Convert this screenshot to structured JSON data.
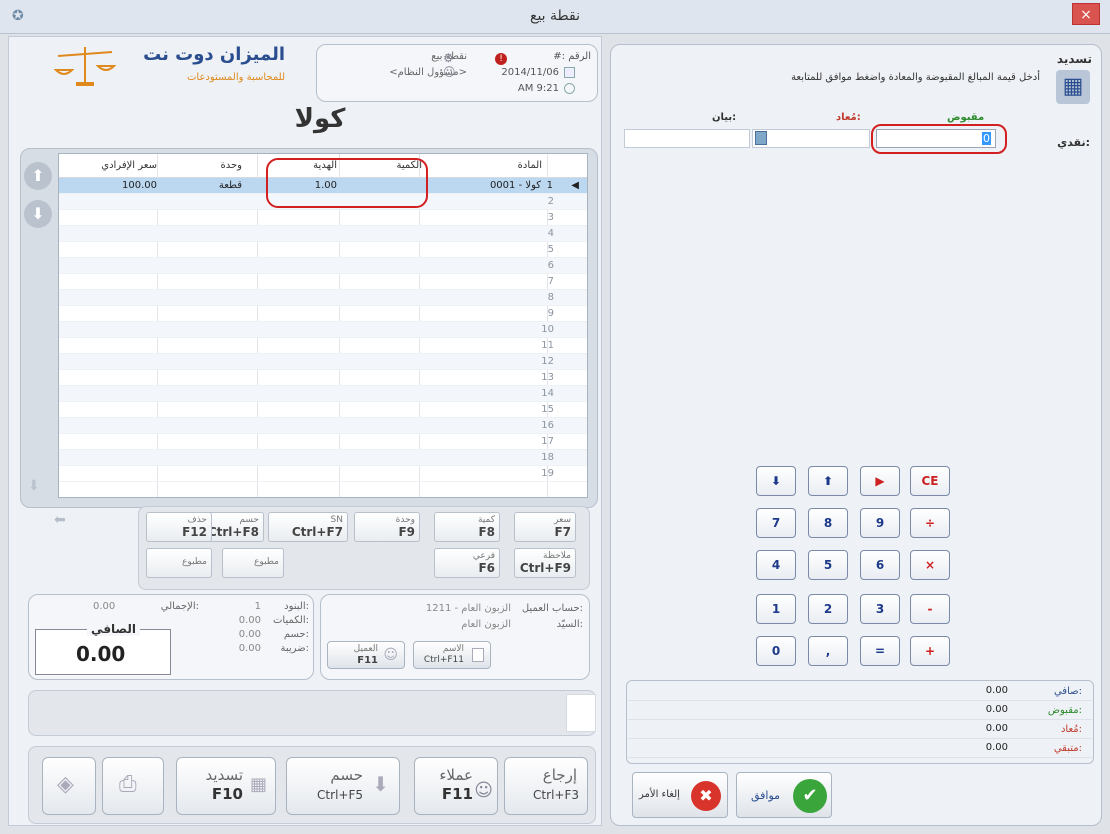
{
  "window": {
    "title": "نقطة بيع",
    "close_label": "×"
  },
  "brand": {
    "name": "الميزان دوت نت",
    "tagline": "للمحاسبة والمستودعات"
  },
  "doc_info": {
    "number_label": "#: الرقم",
    "date": "2014/11/06",
    "time": "AM 9:21",
    "pos_label": "نقطة بيع",
    "user": "<مسؤول النظام>"
  },
  "item_title": "كولا",
  "grid": {
    "headers": {
      "item": "المادة",
      "qty": "الكمية",
      "gift": "الهدية",
      "unit": "وحدة",
      "price": "سعر الإفرادي"
    },
    "first_row": {
      "num": "1",
      "item": "0001 - كولا",
      "gift": "1.00",
      "unit": "قطعة",
      "price": "100.00"
    },
    "row_numbers": [
      "2",
      "3",
      "4",
      "5",
      "6",
      "7",
      "8",
      "9",
      "10",
      "11",
      "12",
      "13",
      "14",
      "15",
      "16",
      "17",
      "18",
      "19"
    ]
  },
  "func_buttons": [
    {
      "name": "price-button",
      "label": "سعر",
      "key": "F7"
    },
    {
      "name": "qty-button",
      "label": "كمية",
      "key": "F8"
    },
    {
      "name": "unit-button",
      "label": "وحدة",
      "key": "F9"
    },
    {
      "name": "sn-button",
      "label": "SN",
      "key": "Ctrl+F7"
    },
    {
      "name": "discount-button",
      "label": "حسم",
      "key": "Ctrl+F8"
    },
    {
      "name": "delete-button",
      "label": "حذف",
      "key": "F12"
    },
    {
      "name": "note-button",
      "label": "ملاحظة",
      "key": "Ctrl+F9"
    },
    {
      "name": "branch-button",
      "label": "فرعي",
      "key": "F6"
    },
    {
      "name": "printed-button-1",
      "label": "مطبوع",
      "key": ""
    },
    {
      "name": "printed-button-2",
      "label": "مطبوع",
      "key": ""
    }
  ],
  "customer": {
    "account_label": "حساب العميل:",
    "account_value": "1211 - الزبون العام",
    "sir_label": "السيّد:",
    "sir_value": "الزبون العام",
    "name_btn_label": "الاسم",
    "name_btn_key": "Ctrl+F11",
    "client_btn_label": "العميل",
    "client_btn_key": "F11"
  },
  "totals": {
    "items_label": "البنود:",
    "items_value": "1",
    "total_label": "الإجمالي:",
    "total_value": "0.00",
    "qty_label": "الكميات:",
    "qty_value": "0.00",
    "disc_label": "حسم:",
    "disc_value": "0.00",
    "tax_label": "ضريبة:",
    "tax_value": "0.00",
    "net_label": "الصافي",
    "net_value": "0.00"
  },
  "bottom_buttons": {
    "return_label": "إرجاع",
    "return_key": "Ctrl+F3",
    "clients_label": "عملاء",
    "clients_key": "F11",
    "discount_label": "حسم",
    "discount_key": "Ctrl+F5",
    "pay_label": "تسديد",
    "pay_key": "F10"
  },
  "payment": {
    "title": "تسديد",
    "instruction": "أدخل قيمة المبالغ المقبوضة والمعادة واضغط موافق للمتابعة",
    "col_received": "مقبوض",
    "col_returned": "مُعاد:",
    "col_statement": "بيان:",
    "cash_label": "نقدي:",
    "cash_value": "0"
  },
  "keypad": {
    "row1": [
      "⬇",
      "⬆",
      "▶",
      "CE"
    ],
    "row2": [
      "7",
      "8",
      "9",
      "÷"
    ],
    "row3": [
      "4",
      "5",
      "6",
      "×"
    ],
    "row4": [
      "1",
      "2",
      "3",
      "-"
    ],
    "row5": [
      "0",
      ",",
      "=",
      "+"
    ]
  },
  "summary": [
    {
      "label": "صافي:",
      "value": "0.00"
    },
    {
      "label": "مقبوض:",
      "value": "0.00"
    },
    {
      "label": "مُعاد:",
      "value": "0.00"
    },
    {
      "label": "متبقي:",
      "value": "0.00"
    }
  ],
  "actions": {
    "ok_label": "موافق",
    "cancel_label": "إلغاء الأمر"
  },
  "colors": {
    "highlight_red": "#d21f1f",
    "green_label": "#2e8b2e",
    "red_label": "#c0392b",
    "selection": "#bcd8f1"
  }
}
